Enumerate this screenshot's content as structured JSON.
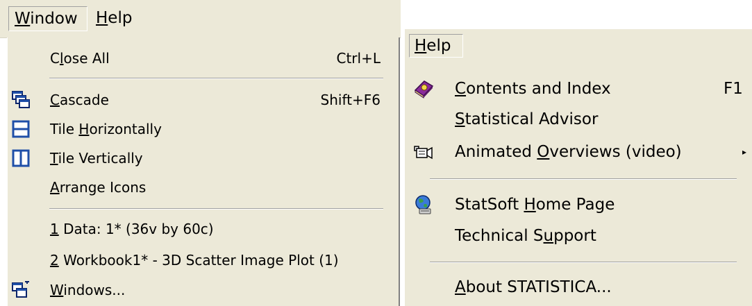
{
  "left_menubar": {
    "window": {
      "pre": "",
      "key": "W",
      "post": "indow"
    },
    "help": {
      "pre": "",
      "key": "H",
      "post": "elp"
    }
  },
  "window_menu": {
    "close_all": {
      "pre": "C",
      "key": "l",
      "post": "ose All",
      "shortcut": "Ctrl+L"
    },
    "cascade": {
      "pre": "",
      "key": "C",
      "post": "ascade",
      "shortcut": "Shift+F6",
      "icon": "cascade-icon"
    },
    "tile_horizontally": {
      "pre": "Tile ",
      "key": "H",
      "post": "orizontally",
      "icon": "tile-horizontal-icon"
    },
    "tile_vertically": {
      "pre": "",
      "key": "T",
      "post": "ile Vertically",
      "icon": "tile-vertical-icon"
    },
    "arrange_icons": {
      "pre": "",
      "key": "A",
      "post": "rrange Icons"
    },
    "recent_1": {
      "pre": "",
      "key": "1",
      "post": " Data: 1* (36v by 60c)"
    },
    "recent_2": {
      "pre": "",
      "key": "2",
      "post": " Workbook1* - 3D Scatter Image Plot (1)"
    },
    "windows": {
      "pre": "",
      "key": "W",
      "post": "indows...",
      "icon": "windows-list-icon"
    }
  },
  "right_menubar": {
    "help": {
      "pre": "",
      "key": "H",
      "post": "elp"
    }
  },
  "help_menu": {
    "contents": {
      "pre": "",
      "key": "C",
      "post": "ontents and Index",
      "shortcut": "F1",
      "icon": "help-book-icon"
    },
    "advisor": {
      "pre": "",
      "key": "S",
      "post": "tatistical Advisor"
    },
    "overviews": {
      "pre": "Animated ",
      "key": "O",
      "post": "verviews (video)",
      "icon": "video-camera-icon",
      "submenu": "▸"
    },
    "home_page": {
      "pre": "StatSoft ",
      "key": "H",
      "post": "ome Page",
      "icon": "globe-icon"
    },
    "support": {
      "pre": "Technical S",
      "key": "u",
      "post": "pport"
    },
    "about": {
      "pre": "",
      "key": "A",
      "post": "bout STATISTICA..."
    }
  },
  "colors": {
    "menu_bg": "#ece9d8",
    "icon_blue": "#1f4fa8",
    "icon_dark": "#0a246a"
  }
}
